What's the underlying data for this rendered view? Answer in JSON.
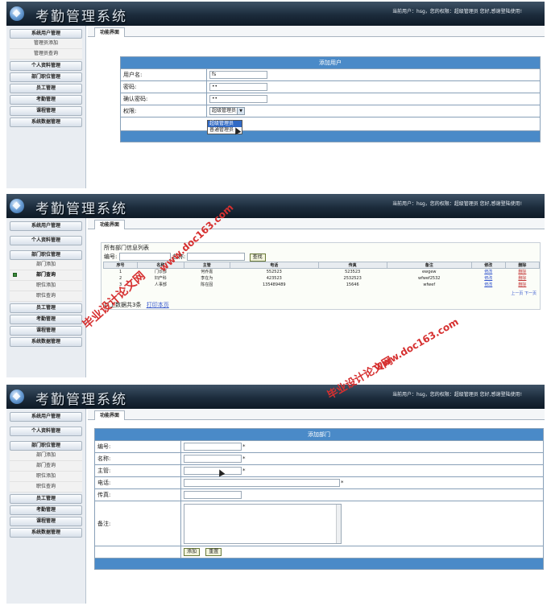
{
  "app": {
    "title": "考勤管理系统",
    "user_info": "当前用户：hsg，您的权限：超级管理员 您好,感谢登陆使用!",
    "tab_label": "功能界面"
  },
  "menu": {
    "system_user": "系统用户管理",
    "admin_add": "管理员添加",
    "admin_query": "管理员查询",
    "personal": "个人资料管理",
    "dept_position": "部门职位管理",
    "employee": "员工管理",
    "attendance": "考勤管理",
    "course": "课程管理",
    "system_data": "系统数据管理",
    "dept_add": "部门添加",
    "dept_query": "部门查询",
    "position_add": "职位添加",
    "position_query": "职位查询"
  },
  "add_user": {
    "header": "添加用户",
    "username_label": "用户名:",
    "username_value": "fs",
    "password_label": "密码:",
    "password_value": "••",
    "confirm_label": "确认密码:",
    "confirm_value": "••",
    "role_label": "权限:",
    "role_selected": "超级管理员",
    "role_options": [
      "超级管理员",
      "普通管理员"
    ]
  },
  "dept_list": {
    "title": "所有部门信息列表",
    "id_label": "编号:",
    "name_label": "名称:",
    "search_button": "查找",
    "columns": [
      "序号",
      "名称",
      "主管",
      "电话",
      "传真",
      "备注",
      "修改",
      "删除"
    ],
    "rows": [
      [
        "1",
        "门诊部",
        "何乔嘉",
        "552523",
        "523523",
        "ewgew",
        "修改",
        "删除"
      ],
      [
        "2",
        "妇产科",
        "李在为",
        "423523",
        "2532523",
        "wfwef2532",
        "修改",
        "删除"
      ],
      [
        "3",
        "人事部",
        "陈在固",
        "135489489",
        "15646",
        "wfwef",
        "修改",
        "删除"
      ]
    ],
    "pager": "上一页 下一页",
    "summary": "以上数据共3条",
    "print_link": "打印本页"
  },
  "add_dept": {
    "header": "添加部门",
    "id_label": "编号:",
    "name_label": "名称:",
    "manager_label": "主管:",
    "phone_label": "电话:",
    "fax_label": "传真:",
    "note_label": "备注:",
    "required_mark": "*",
    "add_button": "添加",
    "reset_button": "重置"
  },
  "watermark": {
    "line1": "毕业设计论文网",
    "line2": "www.doc163.com"
  }
}
